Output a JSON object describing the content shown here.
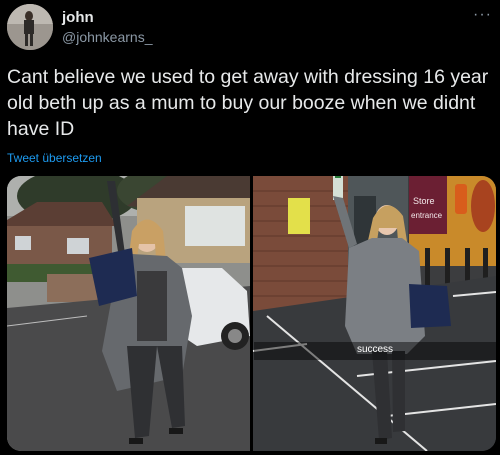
{
  "tweet": {
    "author_name": "john",
    "author_handle": "@johnkearns_",
    "more_icon": "ellipsis-icon",
    "text": "Cant believe we used to get away with dressing 16 year old beth up as a mum to buy our booze when we didnt have ID",
    "translate_label": "Tweet übersetzen"
  },
  "media": {
    "right_photo": {
      "caption": "success",
      "sign_store": "Store",
      "sign_entrance": "entrance"
    }
  }
}
